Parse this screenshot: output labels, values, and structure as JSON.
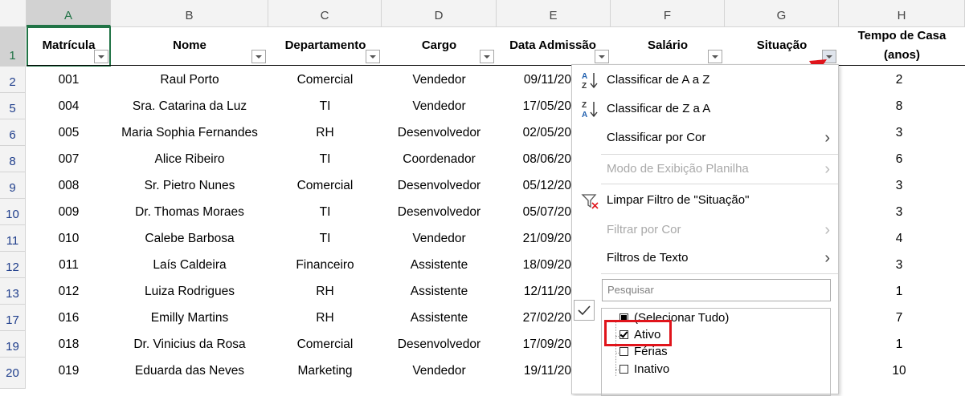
{
  "columns": [
    "A",
    "B",
    "C",
    "D",
    "E",
    "F",
    "G",
    "H"
  ],
  "row_numbers": [
    "1",
    "2",
    "5",
    "6",
    "8",
    "9",
    "10",
    "11",
    "12",
    "13",
    "17",
    "19",
    "20"
  ],
  "headers": {
    "matricula": "Matrícula",
    "nome": "Nome",
    "departamento": "Departamento",
    "cargo": "Cargo",
    "data_admissao": "Data Admissão",
    "salario": "Salário",
    "situacao": "Situação",
    "tempo_line1": "Tempo de Casa",
    "tempo_line2": "(anos)"
  },
  "rows": [
    {
      "matricula": "001",
      "nome": "Raul Porto",
      "departamento": "Comercial",
      "cargo": "Vendedor",
      "data": "09/11/20",
      "tempo": "2"
    },
    {
      "matricula": "004",
      "nome": "Sra. Catarina da Luz",
      "departamento": "TI",
      "cargo": "Vendedor",
      "data": "17/05/20",
      "tempo": "8"
    },
    {
      "matricula": "005",
      "nome": "Maria Sophia Fernandes",
      "departamento": "RH",
      "cargo": "Desenvolvedor",
      "data": "02/05/20",
      "tempo": "3"
    },
    {
      "matricula": "007",
      "nome": "Alice Ribeiro",
      "departamento": "TI",
      "cargo": "Coordenador",
      "data": "08/06/20",
      "tempo": "6"
    },
    {
      "matricula": "008",
      "nome": "Sr. Pietro Nunes",
      "departamento": "Comercial",
      "cargo": "Desenvolvedor",
      "data": "05/12/20",
      "tempo": "3"
    },
    {
      "matricula": "009",
      "nome": "Dr. Thomas Moraes",
      "departamento": "TI",
      "cargo": "Desenvolvedor",
      "data": "05/07/20",
      "tempo": "3"
    },
    {
      "matricula": "010",
      "nome": "Calebe Barbosa",
      "departamento": "TI",
      "cargo": "Vendedor",
      "data": "21/09/20",
      "tempo": "4"
    },
    {
      "matricula": "011",
      "nome": "Laís Caldeira",
      "departamento": "Financeiro",
      "cargo": "Assistente",
      "data": "18/09/20",
      "tempo": "3"
    },
    {
      "matricula": "012",
      "nome": "Luiza Rodrigues",
      "departamento": "RH",
      "cargo": "Assistente",
      "data": "12/11/20",
      "tempo": "1"
    },
    {
      "matricula": "016",
      "nome": "Emilly Martins",
      "departamento": "RH",
      "cargo": "Assistente",
      "data": "27/02/20",
      "tempo": "7"
    },
    {
      "matricula": "018",
      "nome": "Dr. Vinicius da Rosa",
      "departamento": "Comercial",
      "cargo": "Desenvolvedor",
      "data": "17/09/20",
      "tempo": "1"
    },
    {
      "matricula": "019",
      "nome": "Eduarda das Neves",
      "departamento": "Marketing",
      "cargo": "Vendedor",
      "data": "19/11/20",
      "tempo": "10"
    }
  ],
  "menu": {
    "sort_az": "Classificar de A a Z",
    "sort_za": "Classificar de Z a A",
    "sort_color": "Classificar por Cor",
    "sheet_view": "Modo de Exibição Planilha",
    "clear_filter": "Limpar Filtro de \"Situação\"",
    "filter_color": "Filtrar por Cor",
    "text_filters": "Filtros de Texto",
    "search_placeholder": "Pesquisar",
    "list": [
      {
        "label": "(Selecionar Tudo)",
        "state": "partial"
      },
      {
        "label": "Ativo",
        "state": "checked"
      },
      {
        "label": "Férias",
        "state": "unchecked"
      },
      {
        "label": "Inativo",
        "state": "unchecked"
      }
    ]
  },
  "colors": {
    "excel_green": "#217346",
    "highlight_red": "#e0141b",
    "row_number_blue": "#1f3e8c"
  }
}
